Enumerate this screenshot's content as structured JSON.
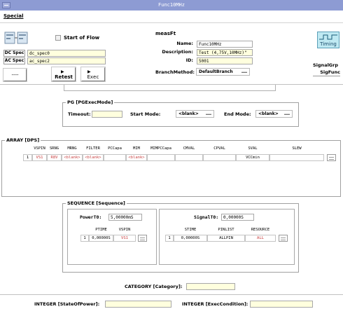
{
  "window": {
    "title": "Func10MHz"
  },
  "menubar": {
    "special": "Special"
  },
  "flow": {
    "start_of_flow_label": "Start of Flow",
    "dc_spec_label": "DC Spec",
    "dc_spec_value": "dc_spec0",
    "ac_spec_label": "AC Spec",
    "ac_spec_value": "ac_spec2",
    "dash_button": "----",
    "retest_button": "Retest",
    "exec_button": "Exec"
  },
  "measft": {
    "title": "measFt",
    "name_label": "Name:",
    "name_value": "Func10MHz",
    "description_label": "Description:",
    "description_value": "Test (4,75V,10MHz)\"",
    "id_label": "ID:",
    "id_value": "5001",
    "branch_label": "BranchMethod:",
    "branch_value": "DefaultBranch"
  },
  "right": {
    "timing_button": "Timing",
    "signalgrp_label": "SignalGrp",
    "sigfunc_button": "SigFunc"
  },
  "pg": {
    "title": "PG [PGExecMode]",
    "timeout_label": "Timeout:",
    "timeout_value": "",
    "start_mode_label": "Start Mode:",
    "start_mode_value": "<blank>",
    "end_mode_label": "End Mode:",
    "end_mode_value": "<blank>"
  },
  "array": {
    "title": "ARRAY [DPS]",
    "columns": [
      "VSPIN",
      "SRNG",
      "MRNG",
      "FILTER",
      "PCCapa",
      "MIM",
      "MIMPCCapa",
      "CMVAL",
      "CPVAL",
      "SVAL",
      "SLEW"
    ],
    "row": {
      "index": "1",
      "cells": [
        "VS1",
        "R8V",
        "<blank>",
        "<blank>",
        "",
        "<blank>",
        "",
        "",
        "",
        "VCCmin",
        ""
      ]
    }
  },
  "sequence": {
    "title": "SEQUENCE [Sequence]",
    "power": {
      "label": "PowerT0:",
      "value": "5,00000mS",
      "columns": [
        "PTIME",
        "VSPIN"
      ],
      "row": {
        "index": "1",
        "cells": [
          "0,00000S",
          "VS1"
        ]
      }
    },
    "signal": {
      "label": "SignalT0:",
      "value": "0,00000S",
      "columns": [
        "STIME",
        "PINLIST",
        "RESOURCE"
      ],
      "row": {
        "index": "1",
        "cells": [
          "0,00000S",
          "ALLPIN",
          "ALL"
        ]
      }
    }
  },
  "category": {
    "label": "CATEGORY [Category]:",
    "value": ""
  },
  "integer_state": {
    "label": "INTEGER [StateOfPower]:",
    "value": ""
  },
  "integer_exec": {
    "label": "INTEGER [ExecCondition]:",
    "value": ""
  },
  "colors": {
    "titlebar": "#8d9bd3",
    "field_bg": "#ffffde",
    "red_text": "#c84040",
    "timing_bg": "#bfe9f2"
  }
}
